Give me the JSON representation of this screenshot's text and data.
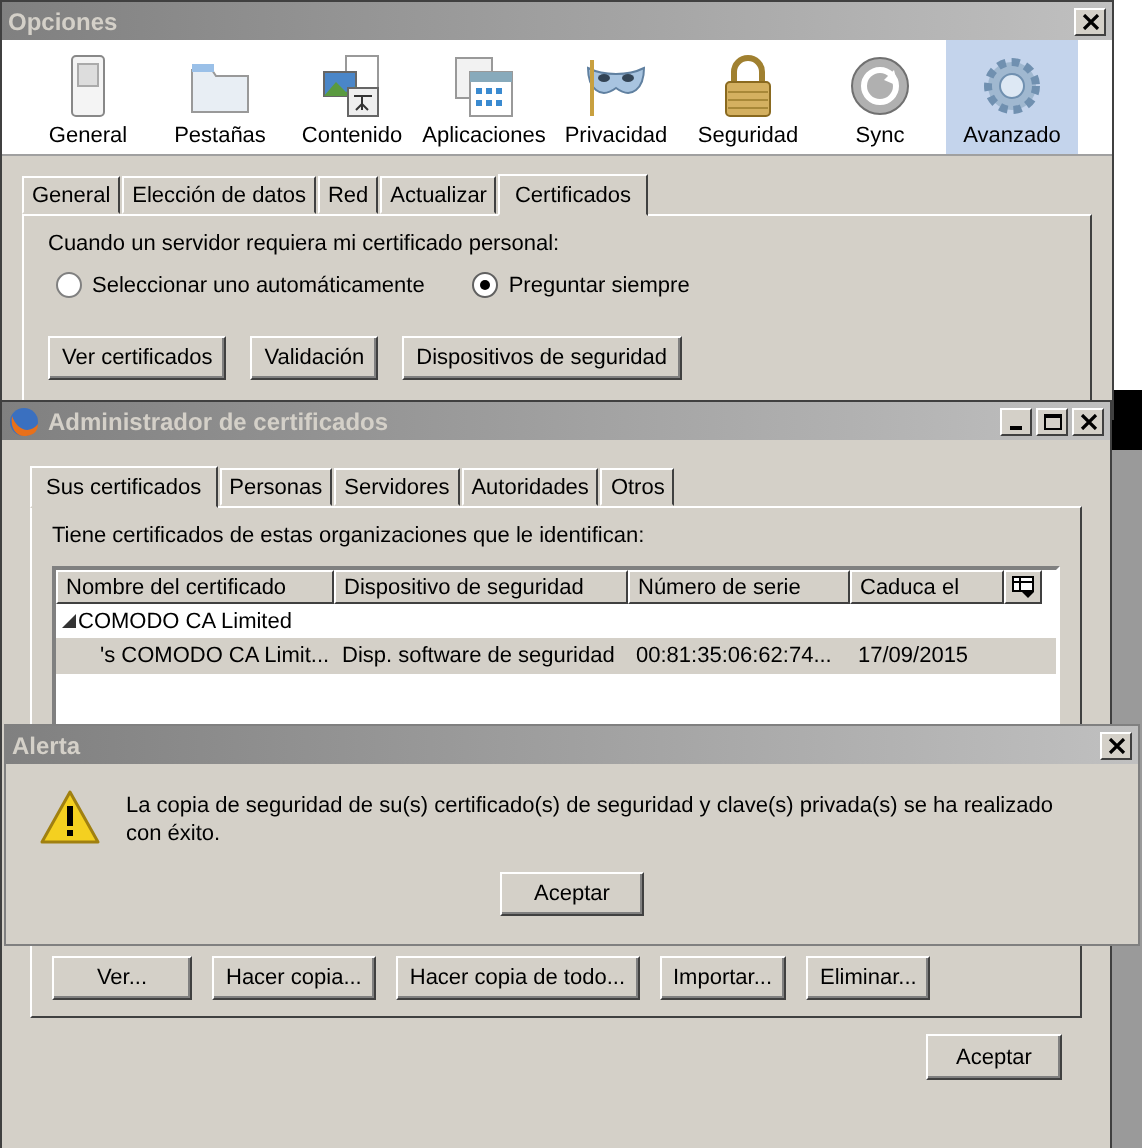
{
  "options_window": {
    "title": "Opciones",
    "categories": [
      {
        "label": "General",
        "selected": false
      },
      {
        "label": "Pestañas",
        "selected": false
      },
      {
        "label": "Contenido",
        "selected": false
      },
      {
        "label": "Aplicaciones",
        "selected": false
      },
      {
        "label": "Privacidad",
        "selected": false
      },
      {
        "label": "Seguridad",
        "selected": false
      },
      {
        "label": "Sync",
        "selected": false
      },
      {
        "label": "Avanzado",
        "selected": true
      }
    ],
    "tabs": [
      {
        "label": "General",
        "selected": false
      },
      {
        "label": "Elección de datos",
        "selected": false
      },
      {
        "label": "Red",
        "selected": false
      },
      {
        "label": "Actualizar",
        "selected": false
      },
      {
        "label": "Certificados",
        "selected": true
      }
    ],
    "prompt": "Cuando un servidor requiera mi certificado personal:",
    "radios": [
      {
        "label": "Seleccionar uno automáticamente",
        "selected": false
      },
      {
        "label": "Preguntar siempre",
        "selected": true
      }
    ],
    "buttons": [
      "Ver certificados",
      "Validación",
      "Dispositivos de seguridad"
    ]
  },
  "cert_manager": {
    "title": "Administrador de certificados",
    "tabs": [
      {
        "label": "Sus certificados",
        "selected": true
      },
      {
        "label": "Personas",
        "selected": false
      },
      {
        "label": "Servidores",
        "selected": false
      },
      {
        "label": "Autoridades",
        "selected": false
      },
      {
        "label": "Otros",
        "selected": false
      }
    ],
    "description": "Tiene certificados de estas organizaciones que le identifican:",
    "table": {
      "columns": [
        "Nombre del certificado",
        "Dispositivo de seguridad",
        "Número de serie",
        "Caduca el"
      ],
      "groups": [
        {
          "name": "COMODO CA Limited",
          "expanded": true,
          "rows": [
            {
              "cells": [
                "'s COMODO CA Limit...",
                "Disp. software de seguridad",
                "00:81:35:06:62:74...",
                "17/09/2015"
              ],
              "selected": true
            }
          ]
        }
      ]
    },
    "buttons": [
      "Ver...",
      "Hacer copia...",
      "Hacer copia de todo...",
      "Importar...",
      "Eliminar..."
    ],
    "ok_button": "Aceptar"
  },
  "alert": {
    "title": "Alerta",
    "message": "La copia de seguridad de su(s) certificado(s) de seguridad y clave(s) privada(s) se ha realizado con éxito.",
    "button": "Aceptar"
  }
}
